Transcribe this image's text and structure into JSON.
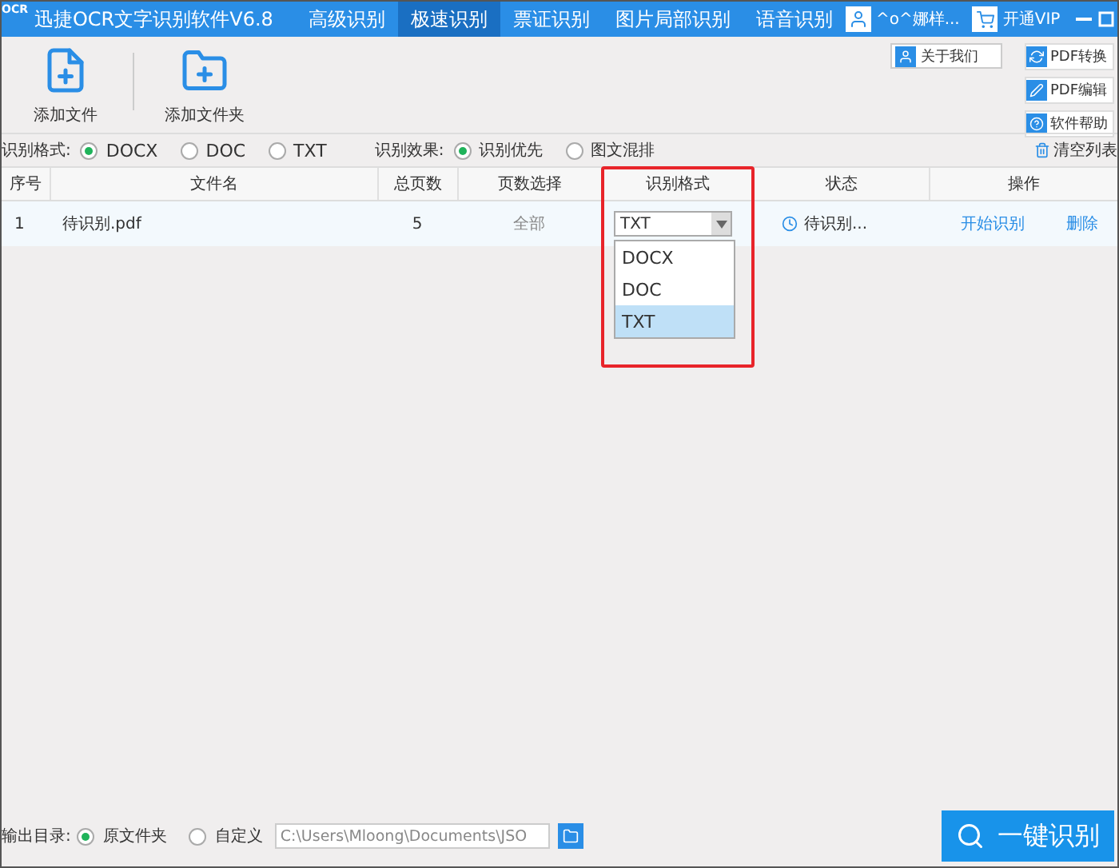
{
  "window": {
    "app_title": "迅捷OCR文字识别软件V6.8",
    "logo_text": "OCR"
  },
  "nav_tabs": [
    {
      "label": "高级识别",
      "selected": false
    },
    {
      "label": "极速识别",
      "selected": true
    },
    {
      "label": "票证识别",
      "selected": false
    },
    {
      "label": "图片局部识别",
      "selected": false
    },
    {
      "label": "语音识别",
      "selected": false
    }
  ],
  "user": {
    "name": "^o^娜样...",
    "vip": "开通VIP"
  },
  "toolbar": [
    {
      "label": "添加文件",
      "kind": "file"
    },
    {
      "label": "添加文件夹",
      "kind": "folder"
    }
  ],
  "about": "关于我们",
  "side_buttons": [
    {
      "label": "PDF转换",
      "kind": "convert"
    },
    {
      "label": "PDF编辑",
      "kind": "edit"
    },
    {
      "label": "软件帮助",
      "kind": "help"
    }
  ],
  "format_options": {
    "label": "识别格式:",
    "options": [
      {
        "label": "DOCX",
        "selected": true
      },
      {
        "label": "DOC",
        "selected": false
      },
      {
        "label": "TXT",
        "selected": false
      }
    ]
  },
  "effect_options": {
    "label": "识别效果:",
    "options": [
      {
        "label": "识别优先",
        "selected": true
      },
      {
        "label": "图文混排",
        "selected": false
      }
    ]
  },
  "clear_list": "清空列表",
  "table": {
    "columns": [
      "序号",
      "文件名",
      "总页数",
      "页数选择",
      "识别格式",
      "状态",
      "操作"
    ],
    "format_column_highlighted": true,
    "rows": [
      {
        "index": "1",
        "file": "待识别.pdf",
        "pages": "5",
        "page_choice": "全部",
        "format": "TXT",
        "status": "待识别...",
        "start": "开始识别",
        "delete": "删除",
        "dropdown": {
          "expanded": true,
          "options": [
            {
              "label": "DOCX",
              "selected": false
            },
            {
              "label": "DOC",
              "selected": false
            },
            {
              "label": "TXT",
              "selected": true
            }
          ]
        }
      }
    ]
  },
  "output": {
    "label": "输出目录:",
    "options": [
      {
        "label": "原文件夹",
        "selected": true
      },
      {
        "label": "自定义",
        "selected": false
      }
    ],
    "path": "C:\\Users\\Mloong\\Documents\\JSO"
  },
  "run_button": "一键识别"
}
